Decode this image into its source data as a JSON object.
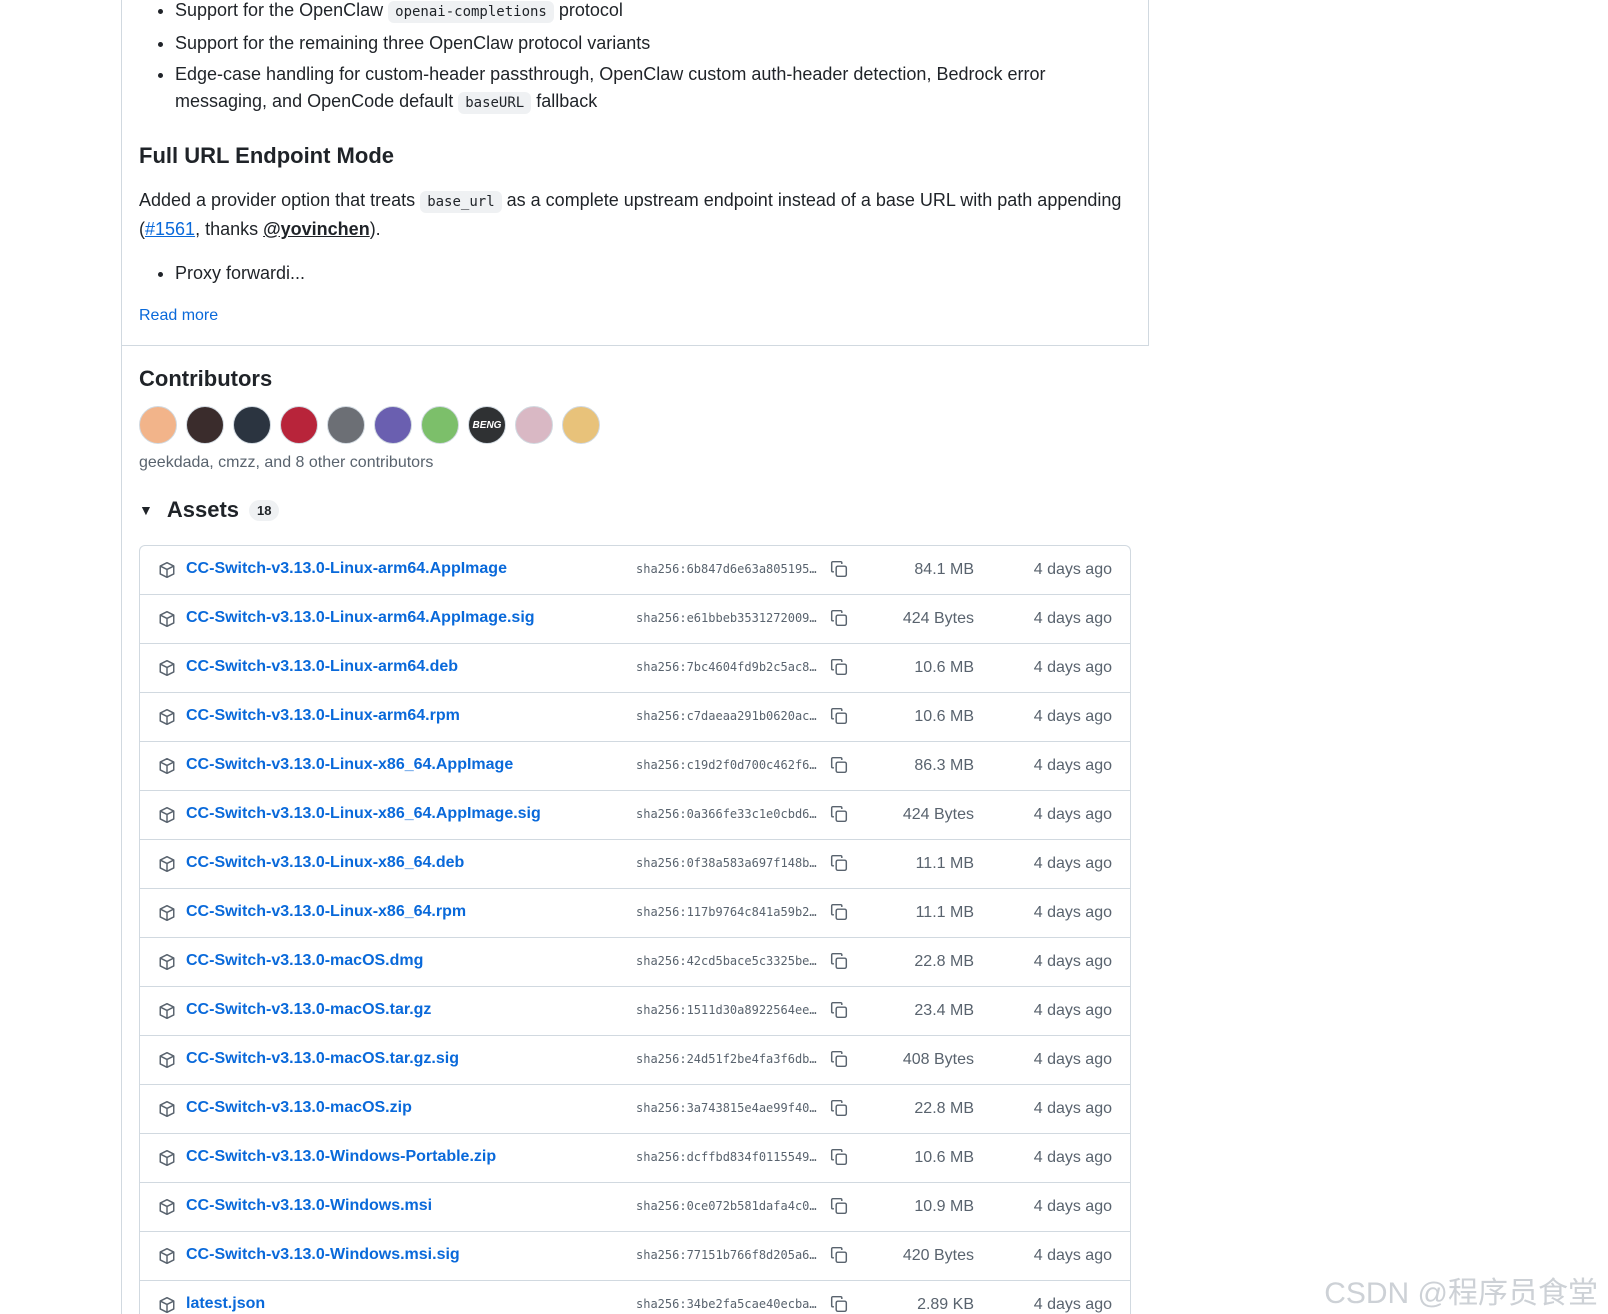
{
  "notes": {
    "bullet1_pre": "Support for the OpenClaw",
    "bullet1_code": "openai-completions",
    "bullet1_post": "protocol",
    "bullet2": "Support for the remaining three OpenClaw protocol variants",
    "bullet3_pre": "Edge-case handling for custom-header passthrough, OpenClaw custom auth-header detection, Bedrock error messaging, and OpenCode default",
    "bullet3_code": "baseURL",
    "bullet3_post": "fallback",
    "heading": "Full URL Endpoint Mode",
    "para_pre": "Added a provider option that treats",
    "para_code": "base_url",
    "para_mid": "as a complete upstream endpoint instead of a base URL with path appending (",
    "para_link": "#1561",
    "para_thanks": ", thanks ",
    "para_mention": "@yovinchen",
    "para_end": ").",
    "bullet4": "Proxy forwardi...",
    "read_more": "Read more"
  },
  "contributors": {
    "title": "Contributors",
    "summary": "geekdada, cmzz, and 8 other contributors",
    "avatars": [
      {
        "color": "#f2b48a"
      },
      {
        "color": "#3a2c2c"
      },
      {
        "color": "#2b3440"
      },
      {
        "color": "#b8243a"
      },
      {
        "color": "#6c6f75"
      },
      {
        "color": "#6a5fb0"
      },
      {
        "color": "#7cbf6a"
      },
      {
        "color": "#2f3133",
        "text": "BENG"
      },
      {
        "color": "#d9b8c4"
      },
      {
        "color": "#e8c27a"
      }
    ]
  },
  "assets": {
    "title": "Assets",
    "count": "18",
    "rows": [
      {
        "name": "CC-Switch-v3.13.0-Linux-arm64.AppImage",
        "sha": "sha256:6b847d6e63a805195…",
        "size": "84.1 MB",
        "date": "4 days ago"
      },
      {
        "name": "CC-Switch-v3.13.0-Linux-arm64.AppImage.sig",
        "sha": "sha256:e61bbeb3531272009…",
        "size": "424 Bytes",
        "date": "4 days ago"
      },
      {
        "name": "CC-Switch-v3.13.0-Linux-arm64.deb",
        "sha": "sha256:7bc4604fd9b2c5ac8…",
        "size": "10.6 MB",
        "date": "4 days ago"
      },
      {
        "name": "CC-Switch-v3.13.0-Linux-arm64.rpm",
        "sha": "sha256:c7daeaa291b0620ac…",
        "size": "10.6 MB",
        "date": "4 days ago"
      },
      {
        "name": "CC-Switch-v3.13.0-Linux-x86_64.AppImage",
        "sha": "sha256:c19d2f0d700c462f6…",
        "size": "86.3 MB",
        "date": "4 days ago"
      },
      {
        "name": "CC-Switch-v3.13.0-Linux-x86_64.AppImage.sig",
        "sha": "sha256:0a366fe33c1e0cbd6…",
        "size": "424 Bytes",
        "date": "4 days ago"
      },
      {
        "name": "CC-Switch-v3.13.0-Linux-x86_64.deb",
        "sha": "sha256:0f38a583a697f148b…",
        "size": "11.1 MB",
        "date": "4 days ago"
      },
      {
        "name": "CC-Switch-v3.13.0-Linux-x86_64.rpm",
        "sha": "sha256:117b9764c841a59b2…",
        "size": "11.1 MB",
        "date": "4 days ago"
      },
      {
        "name": "CC-Switch-v3.13.0-macOS.dmg",
        "sha": "sha256:42cd5bace5c3325be…",
        "size": "22.8 MB",
        "date": "4 days ago"
      },
      {
        "name": "CC-Switch-v3.13.0-macOS.tar.gz",
        "sha": "sha256:1511d30a8922564ee…",
        "size": "23.4 MB",
        "date": "4 days ago"
      },
      {
        "name": "CC-Switch-v3.13.0-macOS.tar.gz.sig",
        "sha": "sha256:24d51f2be4fa3f6db…",
        "size": "408 Bytes",
        "date": "4 days ago"
      },
      {
        "name": "CC-Switch-v3.13.0-macOS.zip",
        "sha": "sha256:3a743815e4ae99f40…",
        "size": "22.8 MB",
        "date": "4 days ago"
      },
      {
        "name": "CC-Switch-v3.13.0-Windows-Portable.zip",
        "sha": "sha256:dcffbd834f0115549…",
        "size": "10.6 MB",
        "date": "4 days ago"
      },
      {
        "name": "CC-Switch-v3.13.0-Windows.msi",
        "sha": "sha256:0ce072b581dafa4c0…",
        "size": "10.9 MB",
        "date": "4 days ago"
      },
      {
        "name": "CC-Switch-v3.13.0-Windows.msi.sig",
        "sha": "sha256:77151b766f8d205a6…",
        "size": "420 Bytes",
        "date": "4 days ago"
      },
      {
        "name": "latest.json",
        "sha": "sha256:34be2fa5cae40ecba…",
        "size": "2.89 KB",
        "date": "4 days ago"
      }
    ]
  },
  "watermark": "CSDN @程序员食堂"
}
